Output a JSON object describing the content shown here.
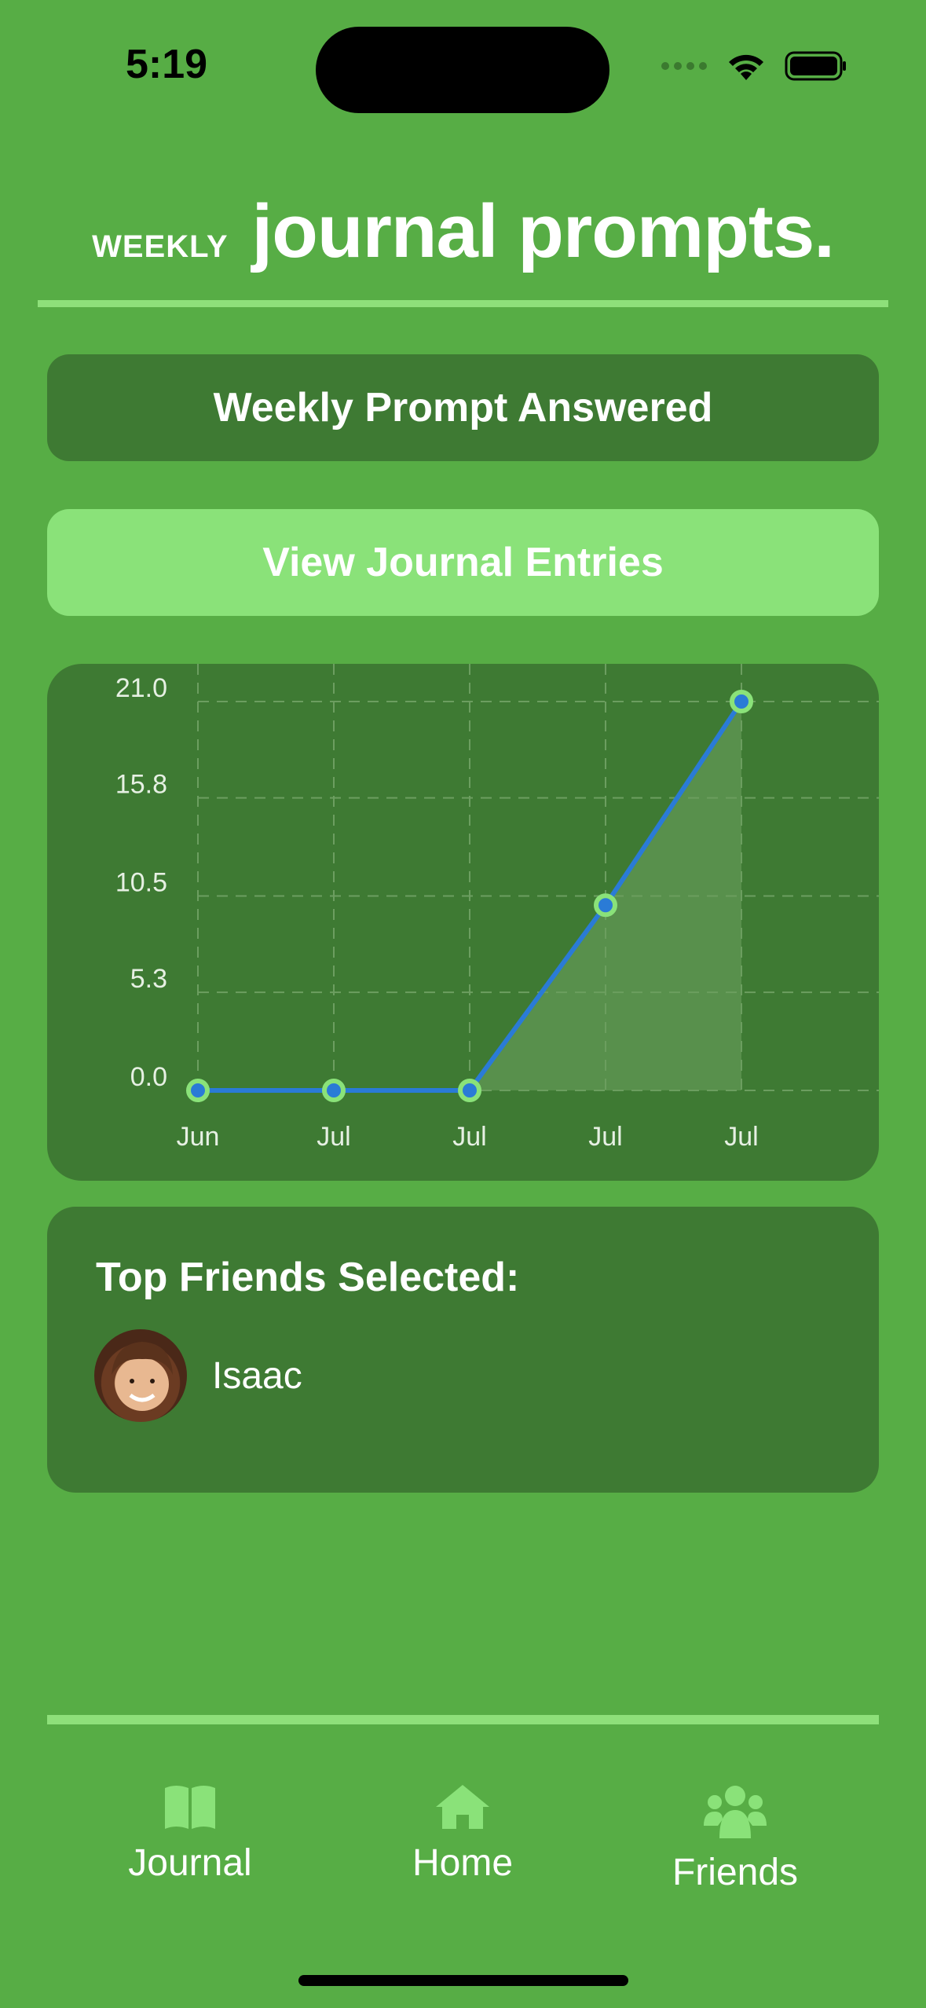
{
  "status_bar": {
    "time": "5:19"
  },
  "header": {
    "small": "WEEKLY",
    "big": "journal prompts."
  },
  "buttons": {
    "answered": "Weekly Prompt Answered",
    "entries": "View Journal Entries"
  },
  "colors": {
    "background": "#57ad45",
    "card": "#3e7a33",
    "accent_light": "#8ae279",
    "line": "#2a7bd6",
    "point_fill": "#2a7bd6",
    "point_stroke": "#8ae279"
  },
  "chart_data": {
    "type": "area",
    "x": [
      "Jun",
      "Jul",
      "Jul",
      "Jul",
      "Jul"
    ],
    "values": [
      0,
      0,
      0,
      10,
      21
    ],
    "yticks": [
      "21.0",
      "15.8",
      "10.5",
      "5.3",
      "0.0"
    ],
    "ylim": [
      0,
      21
    ],
    "grid": true,
    "title": "",
    "xlabel": "",
    "ylabel": ""
  },
  "friends": {
    "title": "Top Friends Selected:",
    "items": [
      {
        "name": "Isaac",
        "icon": "avatar-photo"
      }
    ]
  },
  "tabbar": {
    "items": [
      {
        "label": "Journal",
        "icon": "book-icon"
      },
      {
        "label": "Home",
        "icon": "house-icon"
      },
      {
        "label": "Friends",
        "icon": "people-icon"
      }
    ]
  }
}
